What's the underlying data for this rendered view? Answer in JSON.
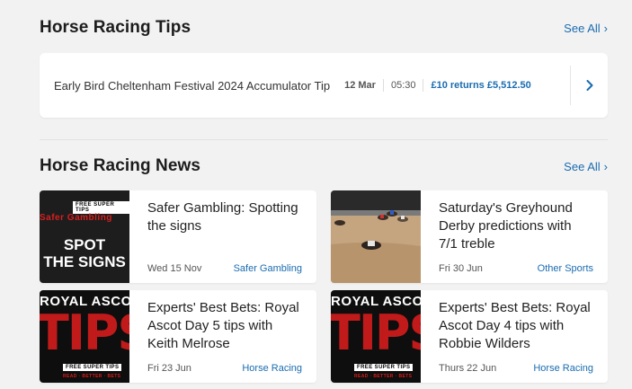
{
  "tips_section": {
    "title": "Horse Racing Tips",
    "see_all": "See All",
    "tip": {
      "title": "Early Bird Cheltenham Festival 2024 Accumulator Tip",
      "date": "12 Mar",
      "time": "05:30",
      "returns": "£10 returns £5,512.50"
    }
  },
  "news_section": {
    "title": "Horse Racing News",
    "see_all": "See All",
    "articles": [
      {
        "title": "Safer Gambling: Spotting the signs",
        "date": "Wed 15 Nov",
        "category": "Safer Gambling",
        "thumb": {
          "logo": "FREE SUPER TIPS",
          "red_text": "Safer Gambling",
          "big_line1": "SPOT",
          "big_line2": "THE SIGNS"
        }
      },
      {
        "title": "Saturday's Greyhound Derby predictions with 7/1 treble",
        "date": "Fri 30 Jun",
        "category": "Other Sports"
      },
      {
        "title": "Experts' Best Bets: Royal Ascot Day 5 tips with Keith Melrose",
        "date": "Fri 23 Jun",
        "category": "Horse Racing",
        "thumb": {
          "top": "ROYAL ASCOT",
          "big": "TIPS",
          "badge": "FREE SUPER TIPS",
          "tag": "READ · BETTER · BETS"
        }
      },
      {
        "title": "Experts' Best Bets: Royal Ascot Day 4 tips with Robbie Wilders",
        "date": "Thurs 22 Jun",
        "category": "Horse Racing",
        "thumb": {
          "top": "ROYAL ASCOT",
          "big": "TIPS",
          "badge": "FREE SUPER TIPS",
          "tag": "READ · BETTER · BETS"
        }
      }
    ]
  },
  "colors": {
    "accent": "#1a6cb0",
    "page_bg": "#f2f2f2",
    "card_bg": "#ffffff",
    "brand_red": "#c11a1a"
  },
  "icons": {
    "see_all": "chevron-right-icon",
    "tip_open": "chevron-right-icon"
  }
}
